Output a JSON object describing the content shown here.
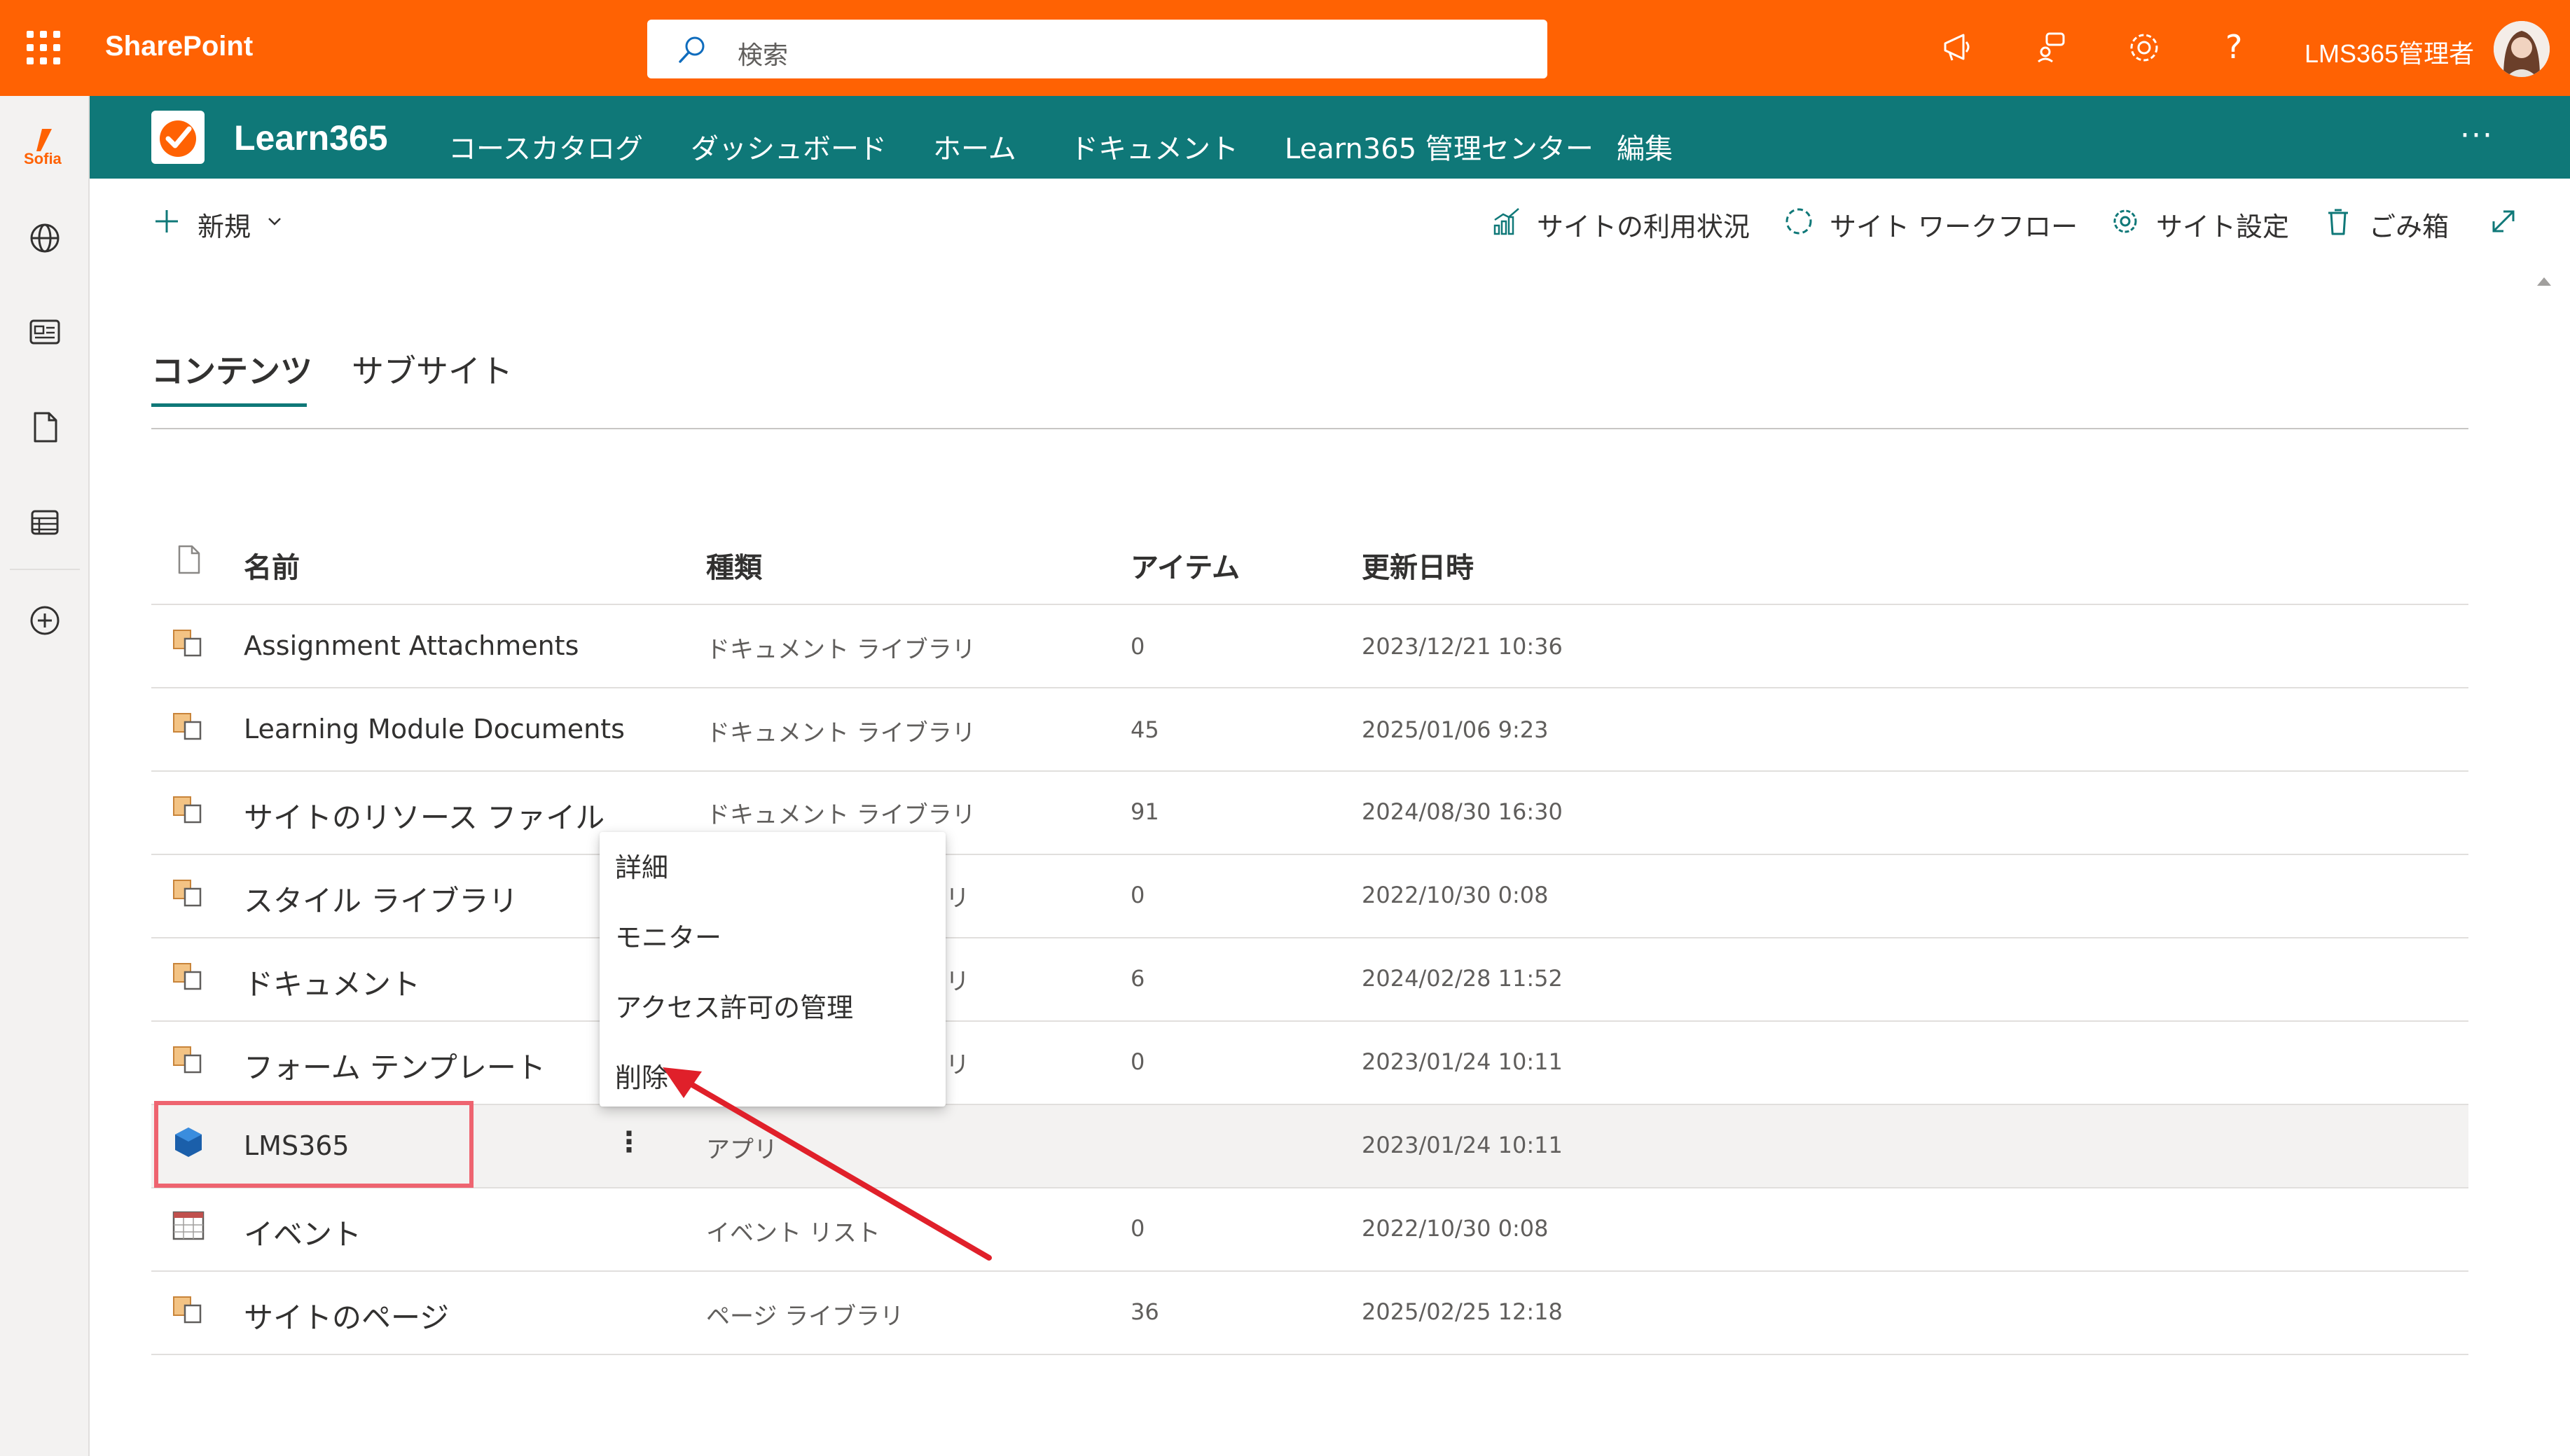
{
  "suite": {
    "app_name": "SharePoint",
    "search_placeholder": "検索",
    "user_name": "LMS365管理者",
    "icons": [
      "waffle-icon",
      "megaphone-icon",
      "community-icon",
      "gear-icon",
      "help-icon",
      "avatar"
    ],
    "help_glyph": "?"
  },
  "rail": {
    "logo_text": "Sofia",
    "icons": [
      "globe-icon",
      "news-icon",
      "document-icon",
      "list-icon",
      "add-icon"
    ]
  },
  "site": {
    "title": "Learn365",
    "nav": [
      "コースカタログ",
      "ダッシュボード",
      "ホーム",
      "ドキュメント",
      "Learn365 管理センター",
      "編集"
    ],
    "more": "···"
  },
  "commandbar": {
    "new_label": "新規",
    "usage_label": "サイトの利用状況",
    "workflow_label": "サイト ワークフロー",
    "settings_label": "サイト設定",
    "recycle_label": "ごみ箱"
  },
  "tabs": {
    "contents": "コンテンツ",
    "subsites": "サブサイト"
  },
  "table": {
    "headers": {
      "name": "名前",
      "type": "種類",
      "items": "アイテム",
      "modified": "更新日時"
    },
    "rows": [
      {
        "name": "Assignment Attachments",
        "type": "ドキュメント ライブラリ",
        "items": "0",
        "modified": "2023/12/21 10:36",
        "icon": "library-icon"
      },
      {
        "name": "Learning Module Documents",
        "type": "ドキュメント ライブラリ",
        "items": "45",
        "modified": "2025/01/06 9:23",
        "icon": "library-icon"
      },
      {
        "name": "サイトのリソース ファイル",
        "type": "ドキュメント ライブラリ",
        "items": "91",
        "modified": "2024/08/30 16:30",
        "icon": "library-icon"
      },
      {
        "name": "スタイル ライブラリ",
        "type": "リ",
        "items": "0",
        "modified": "2022/10/30 0:08",
        "icon": "library-icon"
      },
      {
        "name": "ドキュメント",
        "type": "リ",
        "items": "6",
        "modified": "2024/02/28 11:52",
        "icon": "library-icon"
      },
      {
        "name": "フォーム テンプレート",
        "type": "リ",
        "items": "0",
        "modified": "2023/01/24 10:11",
        "icon": "library-icon"
      },
      {
        "name": "LMS365",
        "type": "アプリ",
        "items": "",
        "modified": "2023/01/24 10:11",
        "icon": "app-cube-icon",
        "more": "⋮"
      },
      {
        "name": "イベント",
        "type": "イベント リスト",
        "items": "0",
        "modified": "2022/10/30 0:08",
        "icon": "calendar-icon"
      },
      {
        "name": "サイトのページ",
        "type": "ページ ライブラリ",
        "items": "36",
        "modified": "2025/02/25 12:18",
        "icon": "library-icon"
      }
    ]
  },
  "context_menu": {
    "items": [
      "詳細",
      "モニター",
      "アクセス許可の管理",
      "削除"
    ]
  },
  "colors": {
    "suite_bar": "#FF6203",
    "site_header": "#0F7878",
    "highlight_box": "#EE6470",
    "arrow": "#E0202A"
  }
}
